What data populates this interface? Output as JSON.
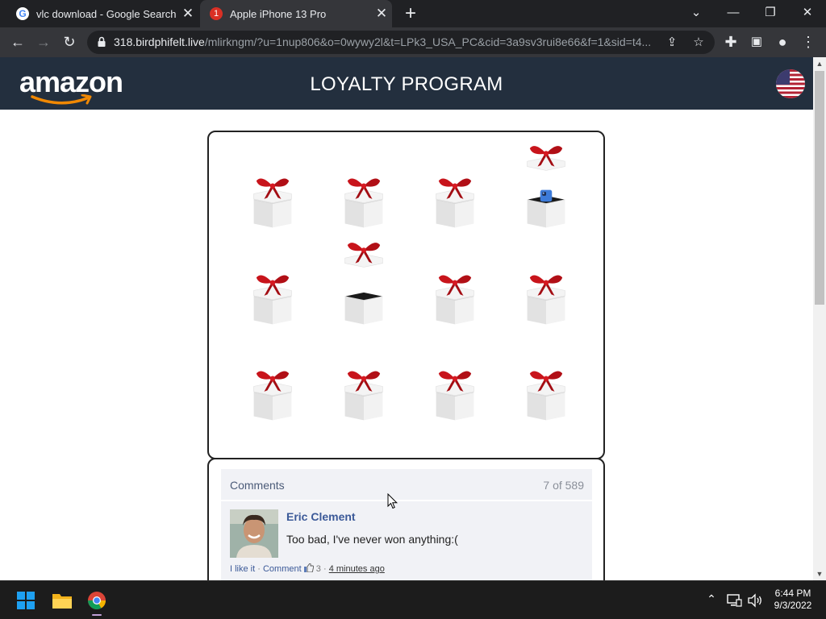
{
  "browser": {
    "tabs": [
      {
        "title": "vlc download - Google Search",
        "favicon": "google-g-icon",
        "active": false
      },
      {
        "title": "Apple iPhone 13 Pro",
        "favicon": "notification-badge-icon",
        "badge": "1",
        "active": true
      }
    ],
    "new_tab": "+",
    "url_host": "318.birdphifelt.live",
    "url_path": "/mlirkngm/?u=1nup806&o=0wywy2l&t=LPk3_USA_PC&cid=3a9sv3rui8e66&f=1&sid=t4..."
  },
  "page": {
    "logo": "amazon",
    "title": "LOYALTY PROGRAM",
    "flag": "us-flag-icon",
    "gifts": [
      {
        "state": "closed"
      },
      {
        "state": "closed"
      },
      {
        "state": "closed"
      },
      {
        "state": "opened-phone"
      },
      {
        "state": "closed"
      },
      {
        "state": "opened-empty"
      },
      {
        "state": "closed"
      },
      {
        "state": "closed"
      },
      {
        "state": "closed"
      },
      {
        "state": "closed"
      },
      {
        "state": "closed"
      },
      {
        "state": "closed"
      }
    ],
    "comments": {
      "label": "Comments",
      "count": "7 of 589",
      "items": [
        {
          "author": "Eric Clement",
          "text": "Too bad, I've never won anything:(",
          "like": "I like it",
          "sep1": "·",
          "reply": "Comment",
          "likes": "3",
          "sep2": "·",
          "time": "4 minutes ago"
        }
      ]
    }
  },
  "taskbar": {
    "time": "6:44 PM",
    "date": "9/3/2022"
  },
  "colors": {
    "header_bg": "#232f3e",
    "ribbon_red": "#c8141b",
    "link_blue": "#3b5998"
  }
}
